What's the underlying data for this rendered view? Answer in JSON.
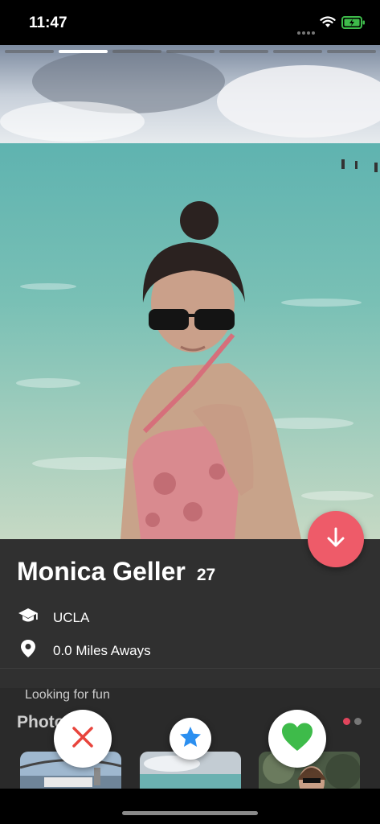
{
  "status": {
    "time": "11:47"
  },
  "profile": {
    "name": "Monica Geller",
    "age": "27",
    "school": "UCLA",
    "distance": "0.0 Miles Aways",
    "bio": "Looking for fun",
    "photos_title": "Photos",
    "photo_count": 7,
    "active_photo_index": 1
  },
  "icons": {
    "school": "graduation-cap-icon",
    "location": "location-pin-icon",
    "down": "arrow-down-icon",
    "dislike": "close-x-icon",
    "superlike": "star-icon",
    "like": "heart-icon"
  },
  "colors": {
    "accent": "#ee5b69",
    "dislike": "#e8443c",
    "superlike": "#2b8ff0",
    "like": "#3ebb4a",
    "panel": "#303030"
  }
}
